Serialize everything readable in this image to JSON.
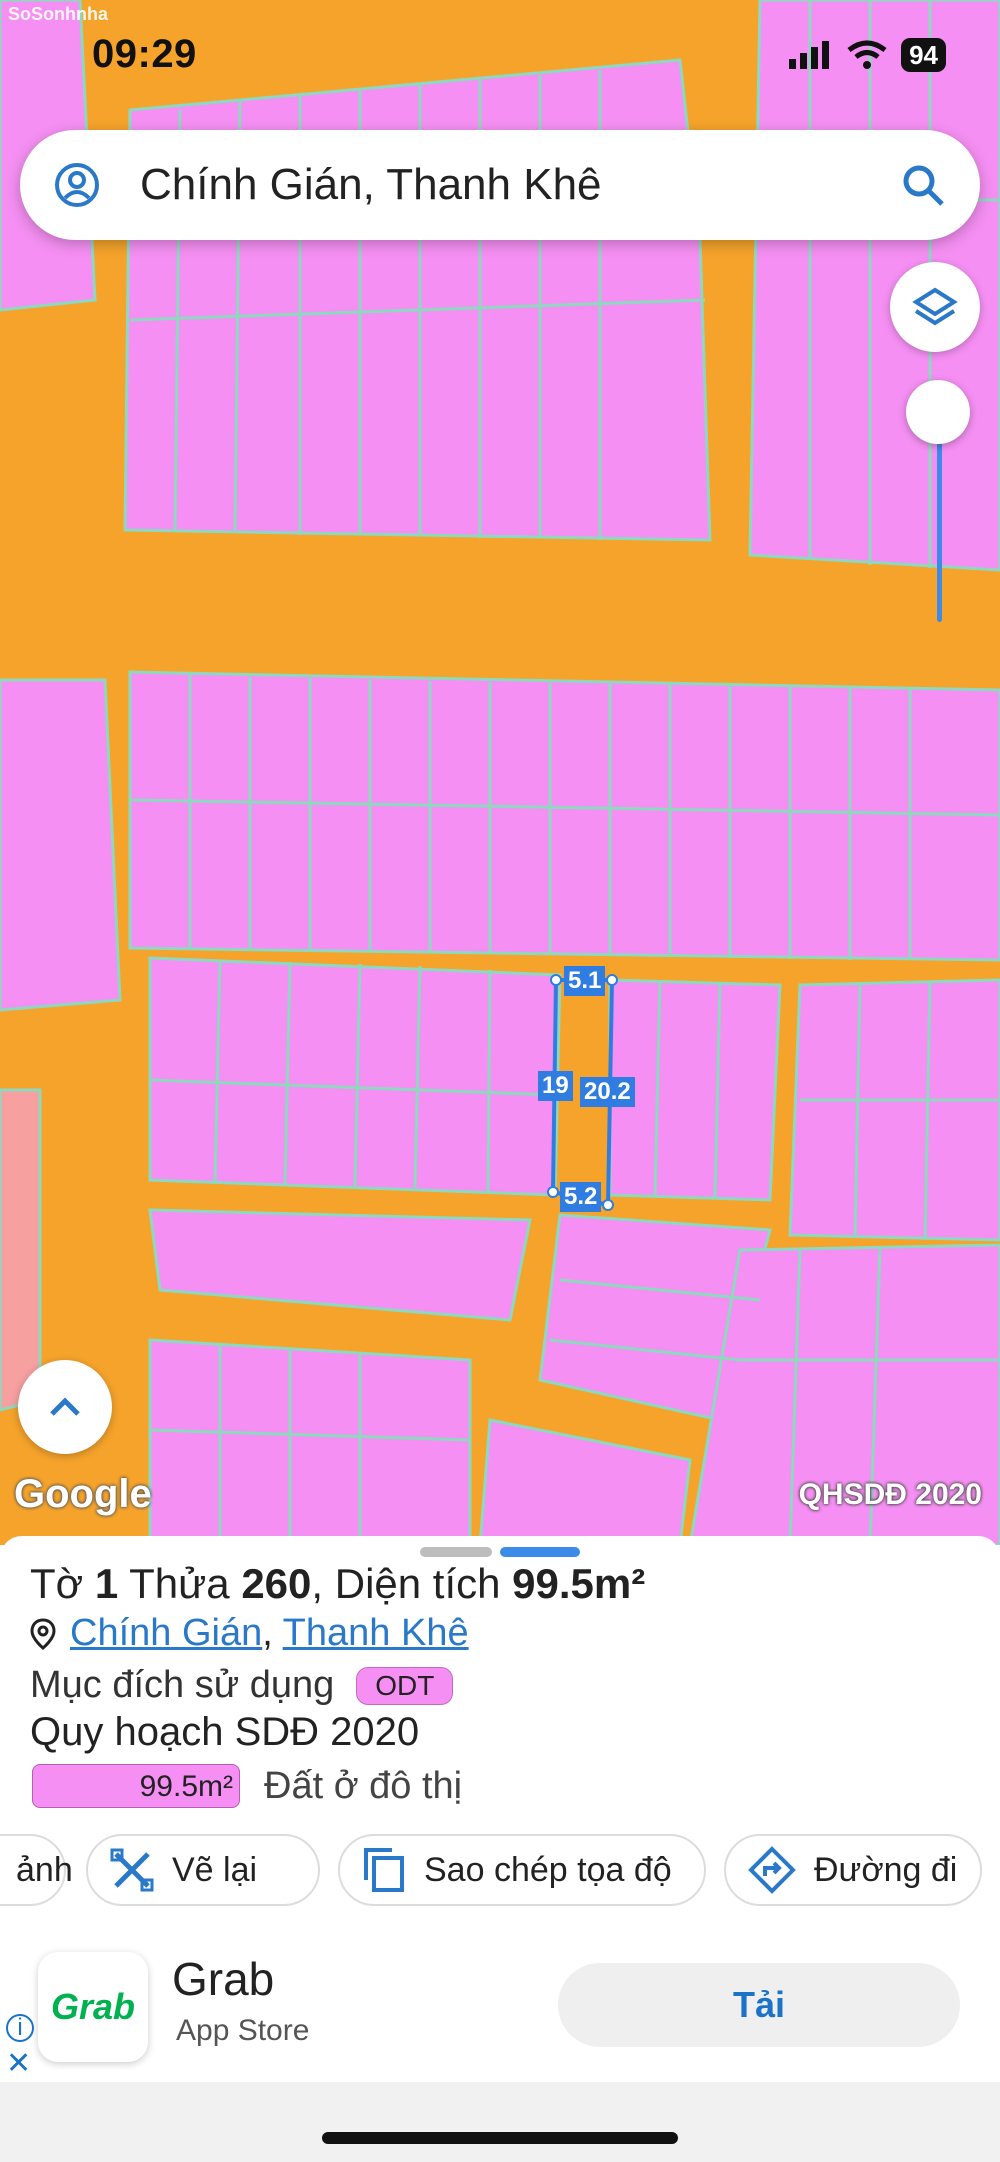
{
  "status_bar": {
    "time": "09:29",
    "battery": "94",
    "watermark": "SoSonhnha"
  },
  "search": {
    "text": "Chính Gián, Thanh Khê"
  },
  "map": {
    "google_label": "Google",
    "layer_label": "QHSDĐ 2020",
    "measurements": {
      "top": "5.1",
      "left": "19",
      "right": "20.2",
      "bottom": "5.2"
    },
    "colors": {
      "residential": "#f58ff3",
      "road": "#f5a32b",
      "boundary": "#8fd8c0",
      "highlight": "#2f7de0"
    }
  },
  "parcel": {
    "to_label": "Tờ",
    "to_number": "1",
    "thua_label": "Thửa",
    "thua_number": "260",
    "area_label": ", Diện tích",
    "area_value": "99.5m²",
    "ward": "Chính Gián",
    "district": "Thanh Khê",
    "purpose_label": "Mục đích sử dụng",
    "purpose_code": "ODT",
    "plan_label": "Quy hoạch SDĐ 2020",
    "plan_area": "99.5m²",
    "plan_use": "Đất ở đô thị"
  },
  "actions": [
    {
      "label": "ảnh"
    },
    {
      "label": "Vẽ lại"
    },
    {
      "label": "Sao chép tọa độ"
    },
    {
      "label": "Đường đi"
    }
  ],
  "ad": {
    "app_name": "Grab",
    "store": "App Store",
    "button": "Tải",
    "logo_text": "Grab"
  }
}
